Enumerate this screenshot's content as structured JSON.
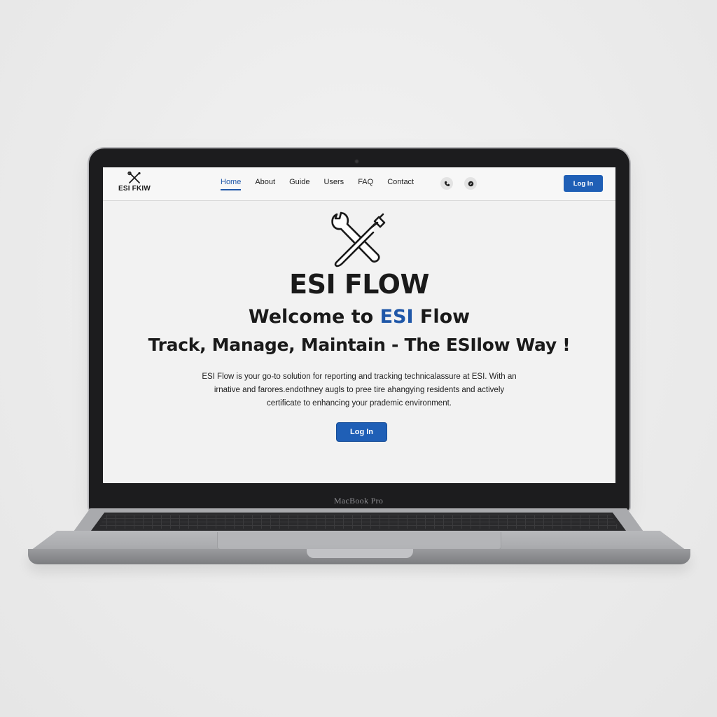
{
  "device": {
    "model_label": "MacBook Pro"
  },
  "header": {
    "brand_name": "ESI FKIW",
    "nav": [
      {
        "label": "Home",
        "active": true
      },
      {
        "label": "About",
        "active": false
      },
      {
        "label": "Guide",
        "active": false
      },
      {
        "label": "Users",
        "active": false
      },
      {
        "label": "FAQ",
        "active": false
      },
      {
        "label": "Contact",
        "active": false
      }
    ],
    "icons": [
      "phone-icon",
      "compass-icon"
    ],
    "login_label": "Log In"
  },
  "hero": {
    "logo_icon": "crossed-wrench-and-screwdriver-icon",
    "wordmark": "ESI FLOW",
    "welcome_prefix": "Welcome to ",
    "welcome_accent": "ESI",
    "welcome_suffix": " Flow",
    "tagline": "Track, Manage, Maintain - The ESIlow Way !",
    "description_lines": [
      "ESI Flow is your go-to solution for reporting and tracking technicalassure at ESI. With an",
      "irnative and farores.endothney augls to pree tire ahangying residents and actively",
      "certificate to enhancing your prademic environment."
    ],
    "cta_label": "Log In"
  },
  "colors": {
    "accent": "#1f57a8",
    "button": "#1f5fb6",
    "text": "#1a1a1a"
  }
}
